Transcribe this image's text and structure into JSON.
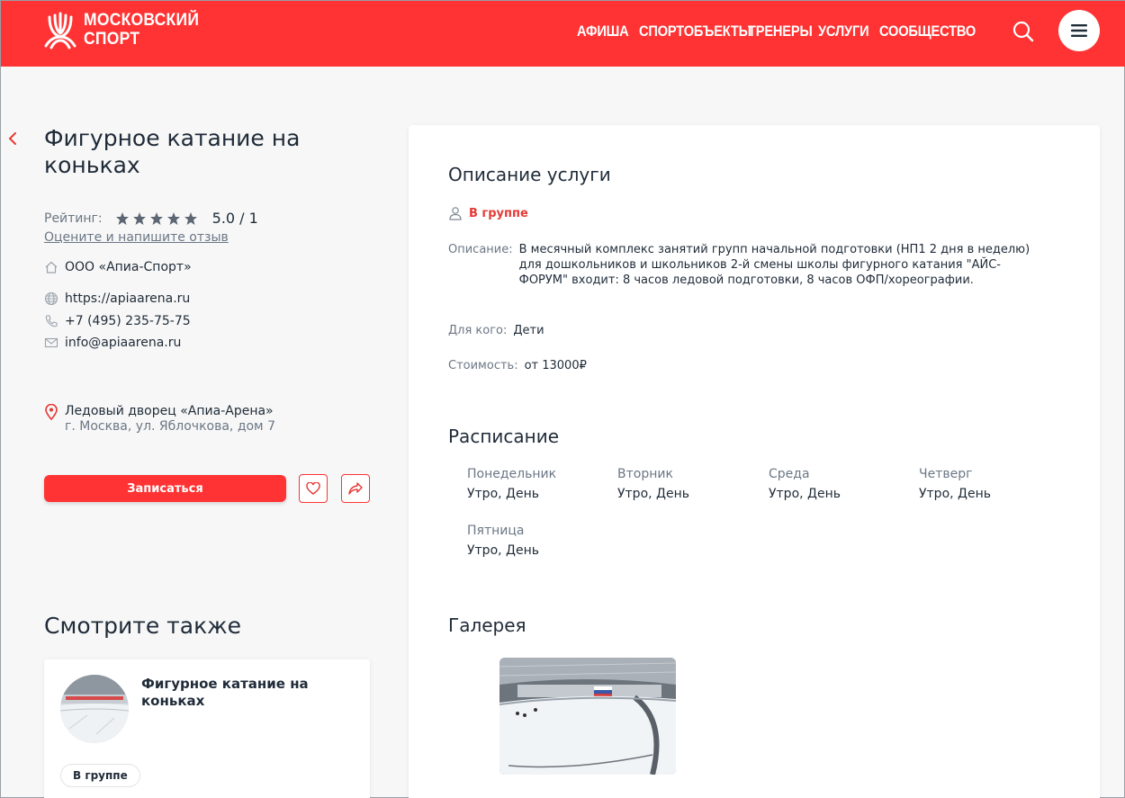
{
  "header": {
    "logo_line1": "МОСКОВСКИЙ",
    "logo_line2": "СПОРТ",
    "nav": [
      "АФИША",
      "СПОРТОБЪЕКТЫ",
      "ТРЕНЕРЫ",
      "УСЛУГИ",
      "СООБЩЕСТВО"
    ],
    "brand_color": "#ff3333"
  },
  "service": {
    "title": "Фигурное катание на коньках",
    "rating_label": "Рейтинг:",
    "rating_stars": 5,
    "rating_value": "5.0 / 1",
    "review_link": "Оцените и напишите отзыв",
    "organization": "ООО «Апиа-Спорт»",
    "website": "https://apiaarena.ru",
    "phone": "+7 (495) 235-75-75",
    "email": "info@apiaarena.ru",
    "venue_name": "Ледовый дворец «Апиа-Арена»",
    "venue_address": "г. Москва, ул. Яблочкова, дом 7",
    "signup_label": "Записаться"
  },
  "see_also": {
    "title": "Смотрите также",
    "card_name": "Фигурное катание на коньках",
    "card_tag": "В группе"
  },
  "description": {
    "title": "Описание услуги",
    "format": "В группе",
    "desc_key": "Описание:",
    "desc_val": "В месячный комплекс занятий групп начальной подготовки (НП1 2 дня в неделю) для дошкольников и школьников 2-й смены школы фигурного катания \"АЙС-ФОРУМ\" входит:  8 часов ледовой подготовки, 8 часов ОФП/хореографии.",
    "audience_key": "Для кого:",
    "audience_val": "Дети",
    "price_key": "Стоимость:",
    "price_val": "от 13000₽"
  },
  "schedule": {
    "title": "Расписание",
    "days": [
      {
        "day": "Понедельник",
        "time": "Утро, День"
      },
      {
        "day": "Вторник",
        "time": "Утро, День"
      },
      {
        "day": "Среда",
        "time": "Утро, День"
      },
      {
        "day": "Четверг",
        "time": "Утро, День"
      },
      {
        "day": "Пятница",
        "time": "Утро, День"
      }
    ]
  },
  "gallery": {
    "title": "Галерея"
  },
  "icons": {
    "search": "search-icon",
    "menu": "hamburger-icon",
    "back": "chevron-left-icon",
    "star": "star-icon",
    "home": "home-icon",
    "globe": "globe-icon",
    "phone": "phone-icon",
    "mail": "mail-icon",
    "pin": "map-pin-icon",
    "heart": "heart-icon",
    "share": "share-icon",
    "user": "user-icon"
  }
}
